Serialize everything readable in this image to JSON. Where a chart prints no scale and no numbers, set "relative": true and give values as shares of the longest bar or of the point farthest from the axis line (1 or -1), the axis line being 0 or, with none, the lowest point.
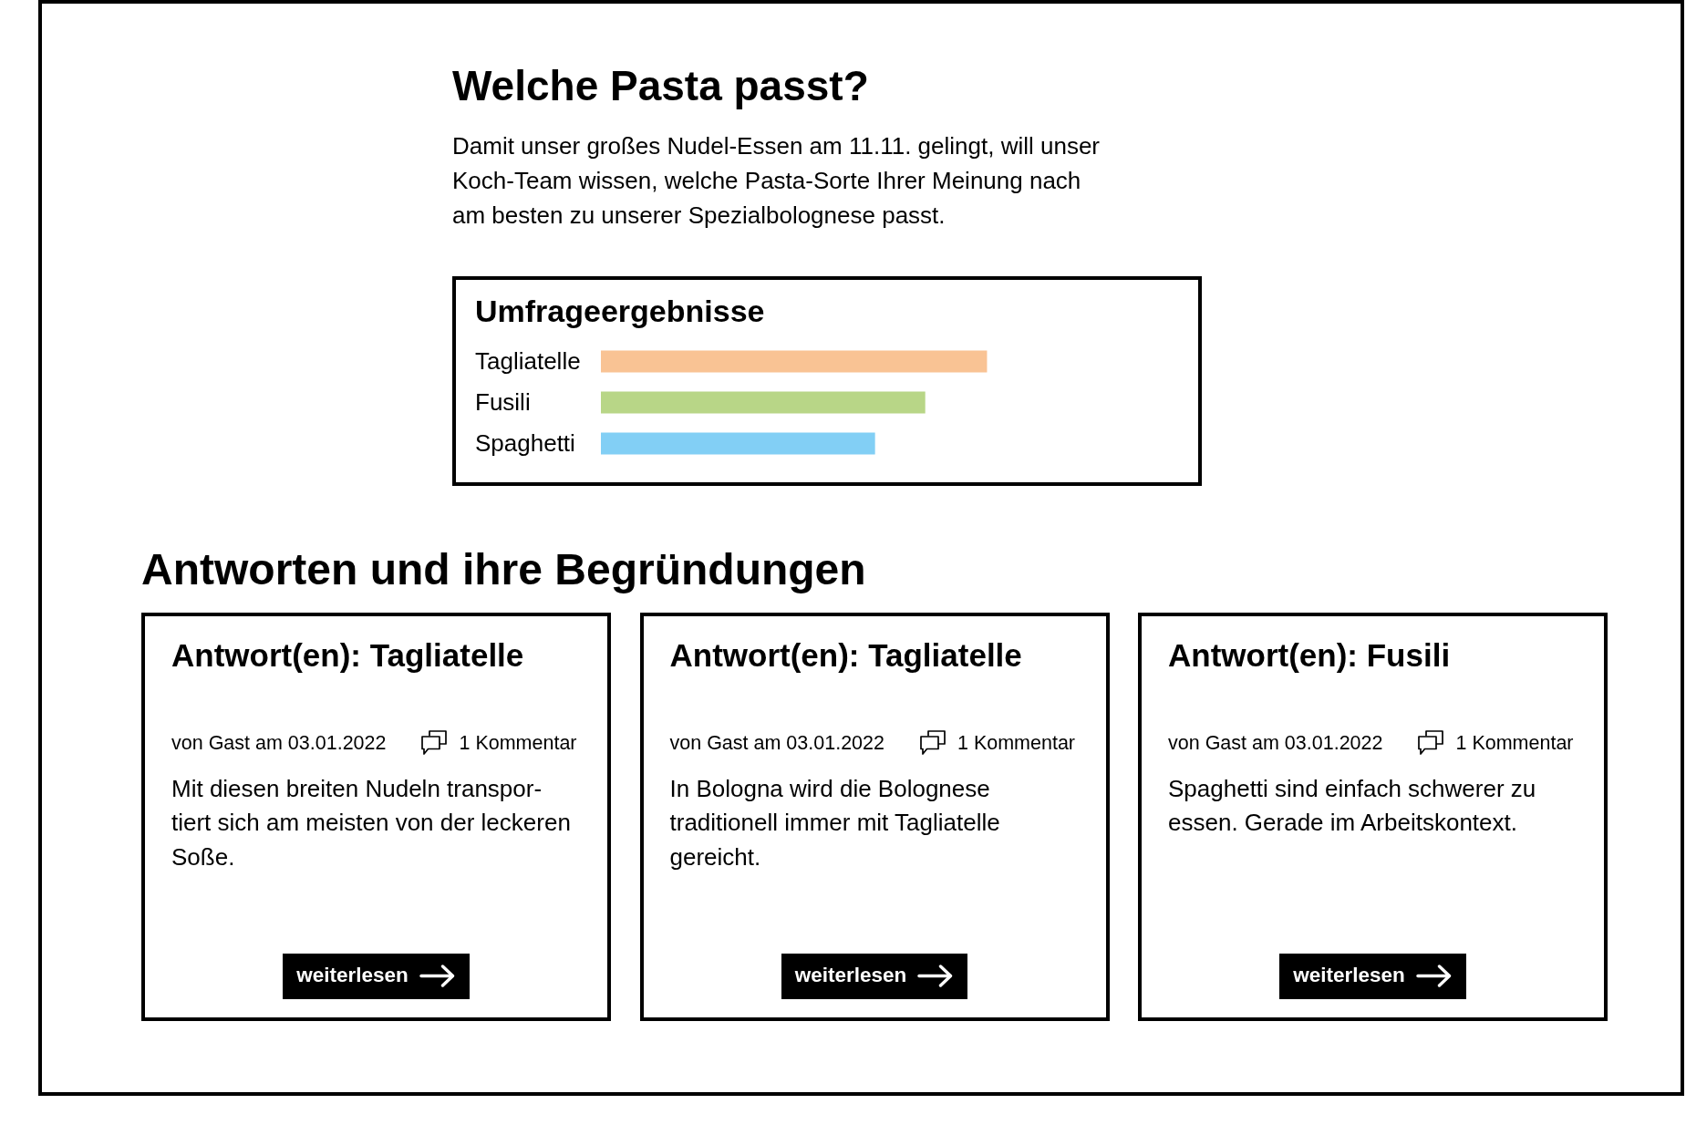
{
  "intro": {
    "title": "Welche Pasta passt?",
    "text": "Damit unser großes Nudel-Essen am 11.11. gelingt, will unser\nKoch-Team wissen, welche Pasta-Sorte Ihrer Meinung nach\nam besten zu unserer Spezialbolognese passt."
  },
  "poll_results": {
    "chart_data": {
      "type": "bar",
      "title": "Umfrageergebnisse",
      "orientation": "horizontal",
      "relative": true,
      "categories": [
        "Tagliatelle",
        "Fusili",
        "Spaghetti"
      ],
      "series": [
        {
          "color": "#f9c394",
          "values": [
            1,
            null,
            null
          ]
        },
        {
          "color": "#b8d687",
          "values": [
            null,
            0.84,
            null
          ]
        },
        {
          "color": "#82cff5",
          "values": [
            null,
            null,
            0.71
          ]
        }
      ]
    }
  },
  "answers": {
    "title": "Antworten und ihre Begründungen",
    "cards": [
      {
        "title": "Antwort(en): Tagliatelle",
        "byline": "von Gast am 03.01.2022",
        "comments": "1 Kommentar",
        "text": "Mit diesen breiten Nudeln transpor-\ntiert sich am meisten von der leckeren\nSoße.",
        "button": "weiterlesen"
      },
      {
        "title": "Antwort(en): Tagliatelle",
        "byline": "von Gast am 03.01.2022",
        "comments": "1 Kommentar",
        "text": "In Bologna wird die Bolognese\ntraditionell immer mit Tagliatelle\ngereicht.",
        "button": "weiterlesen"
      },
      {
        "title": "Antwort(en): Fusili",
        "byline": "von Gast am 03.01.2022",
        "comments": "1 Kommentar",
        "text": "Spaghetti sind einfach schwerer zu\nessen. Gerade im Arbeitskontext.",
        "button": "weiterlesen"
      }
    ]
  }
}
